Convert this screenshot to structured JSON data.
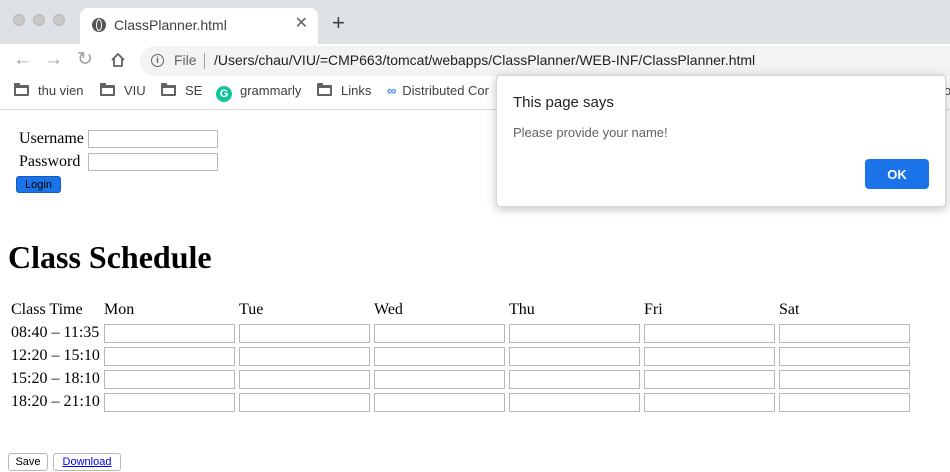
{
  "browser": {
    "tab_title": "ClassPlanner.html",
    "close_glyph": "✕",
    "newtab_glyph": "+",
    "back_glyph": "←",
    "forward_glyph": "→",
    "reload_glyph": "↻",
    "scheme": "File",
    "url": "/Users/chau/VIU/=CMP663/tomcat/webapps/ClassPlanner/WEB-INF/ClassPlanner.html",
    "bookmarks": [
      "thu vien",
      "VIU",
      "SE",
      "grammarly",
      "Links",
      "Distributed Cor"
    ],
    "bookmark_tail": "o"
  },
  "login": {
    "username_label": "Username",
    "password_label": "Password",
    "login_label": "Login"
  },
  "schedule": {
    "title": "Class Schedule",
    "time_header": "Class Time",
    "days": [
      "Mon",
      "Tue",
      "Wed",
      "Thu",
      "Fri",
      "Sat"
    ],
    "times": [
      "08:40 – 11:35",
      "12:20 – 15:10",
      "15:20 – 18:10",
      "18:20 – 21:10"
    ]
  },
  "actions": {
    "save_label": "Save",
    "download_label": "Download"
  },
  "dialog": {
    "title": "This page says",
    "message": "Please provide your name!",
    "ok_label": "OK"
  },
  "colors": {
    "accent": "#1a73e8",
    "tabbar": "#dee1e6"
  }
}
